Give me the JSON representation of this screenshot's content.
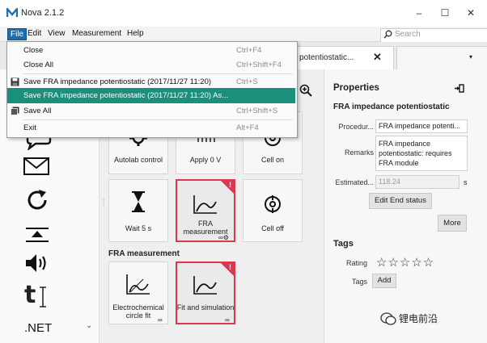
{
  "window": {
    "title": "Nova 2.1.2",
    "controls": {
      "minimize": "–",
      "maximize": "☐",
      "close": "✕"
    }
  },
  "menubar": {
    "items": [
      "File",
      "Edit",
      "View",
      "Measurement",
      "Help"
    ],
    "active": "File",
    "search_placeholder": "Search"
  },
  "file_menu": {
    "items": [
      {
        "label": "Close",
        "shortcut": "Ctrl+F4"
      },
      {
        "label": "Close All",
        "shortcut": "Ctrl+Shift+F4"
      },
      {
        "label": "Save FRA impedance potentiostatic (2017/11/27 11:20)",
        "shortcut": "Ctrl+S"
      },
      {
        "label": "Save FRA impedance potentiostatic (2017/11/27 11:20) As...",
        "shortcut": ""
      },
      {
        "label": "Save All",
        "shortcut": "Ctrl+Shift+S"
      },
      {
        "label": "Exit",
        "shortcut": "Alt+F4"
      }
    ],
    "highlighted_index": 3
  },
  "document_tab": {
    "label": "dance potentiostatic...",
    "close": "✕"
  },
  "toolbox": {
    "icons": [
      "speech-bubble-icon",
      "envelope-icon",
      "refresh-icon",
      "import-icon",
      "speaker-icon",
      "text-cursor-icon"
    ],
    "net_label": ".NET"
  },
  "canvas": {
    "tiles_row1": [
      "Autolab control",
      "Apply 0 V",
      "Cell on"
    ],
    "tiles_row2": [
      "Wait 5 s",
      "FRA measurement",
      "Cell off"
    ],
    "section_label": "FRA measurement",
    "tiles_row3": [
      "Electrochemical circle fit",
      "Fit and simulation"
    ],
    "badge": "!"
  },
  "properties": {
    "title": "Properties",
    "subtitle": "FRA impedance potentiostatic",
    "procedure_label": "Procedur...",
    "procedure_value": "FRA impedance potenti...",
    "remarks_label": "Remarks",
    "remarks_value": [
      "FRA impedance",
      "potentiostatic: requires",
      "FRA module"
    ],
    "estimated_label": "Estimated...",
    "estimated_value": "118.24",
    "estimated_unit": "s",
    "edit_end_status": "Edit End status",
    "more": "More",
    "tags_title": "Tags",
    "rating_label": "Rating",
    "rating_stars": "☆☆☆☆☆",
    "tags_label": "Tags",
    "add": "Add"
  },
  "watermark": "锂电前沿",
  "colors": {
    "accent": "#1a6fb3",
    "menu_highlight": "#1a8f7a",
    "alert_red": "#d9384f"
  }
}
